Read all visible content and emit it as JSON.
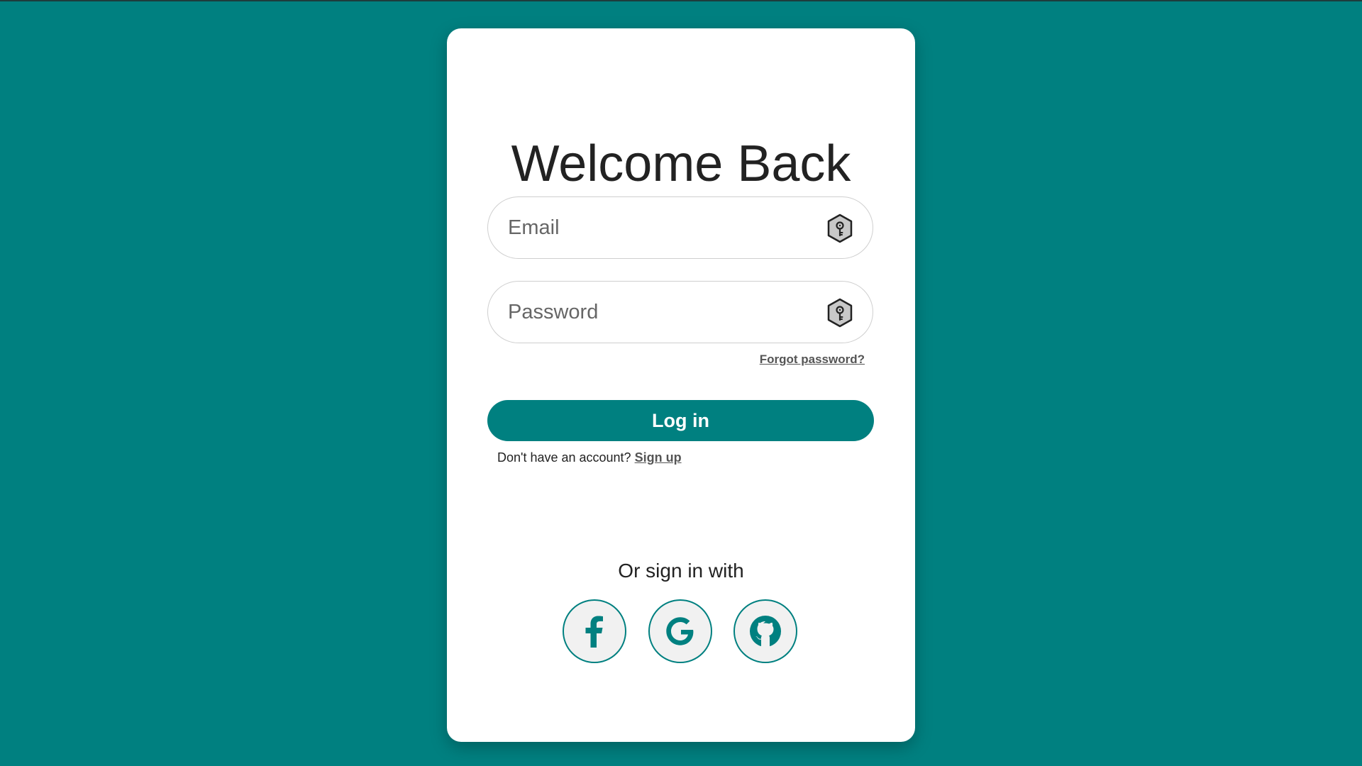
{
  "login": {
    "title": "Welcome Back",
    "email_placeholder": "Email",
    "password_placeholder": "Password",
    "forgot_label": "Forgot password?",
    "login_label": "Log in",
    "no_account_text": "Don't have an account?",
    "signup_label": "Sign up",
    "or_text": "Or sign in with"
  },
  "icons": {
    "field_icon": "key-hexagon-icon",
    "social": [
      "facebook-icon",
      "google-icon",
      "github-icon"
    ]
  },
  "colors": {
    "background": "#008080",
    "accent": "#008080",
    "card": "#ffffff"
  }
}
